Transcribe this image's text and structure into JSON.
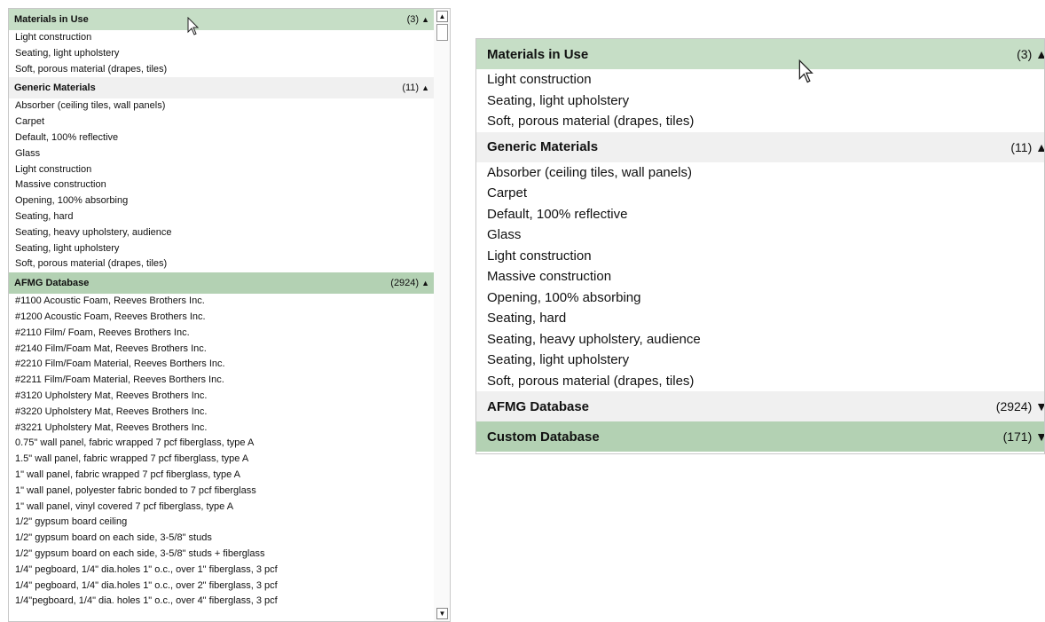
{
  "left_panel": {
    "sections": [
      {
        "title": "Materials in Use",
        "count": "(3)",
        "expanded": true,
        "items": [
          "Light construction",
          "Seating, light upholstery",
          "Soft, porous material (drapes, tiles)"
        ]
      },
      {
        "title": "Generic Materials",
        "count": "(11)",
        "expanded": true,
        "items": [
          "Absorber (ceiling tiles, wall panels)",
          "Carpet",
          "Default, 100% reflective",
          "Glass",
          "Light construction",
          "Massive construction",
          "Opening, 100% absorbing",
          "Seating, hard",
          "Seating, heavy upholstery, audience",
          "Seating, light upholstery",
          "Soft, porous material (drapes, tiles)"
        ]
      },
      {
        "title": "AFMG Database",
        "count": "(2924)",
        "expanded": true,
        "items": [
          "#1100 Acoustic Foam, Reeves Brothers Inc.",
          "#1200 Acoustic Foam, Reeves Brothers Inc.",
          "#2110 Film/ Foam, Reeves Brothers Inc.",
          "#2140 Film/Foam Mat, Reeves Brothers Inc.",
          "#2210 Film/Foam Material, Reeves Borthers Inc.",
          "#2211 Film/Foam Material, Reeves Borthers Inc.",
          "#3120 Upholstery Mat, Reeves Brothers Inc.",
          "#3220 Upholstery Mat, Reeves Brothers Inc.",
          "#3221 Upholstery Mat, Reeves Brothers Inc.",
          "0.75\" wall panel, fabric wrapped 7 pcf fiberglass, type A",
          "1.5\" wall panel, fabric wrapped 7 pcf fiberglass, type A",
          "1\" wall panel, fabric wrapped 7 pcf fiberglass, type A",
          "1\" wall panel, polyester fabric bonded to 7 pcf fiberglass",
          "1\" wall panel, vinyl covered 7 pcf fiberglass, type A",
          "1/2\" gypsum board ceiling",
          "1/2\" gypsum board on each side, 3-5/8\" studs",
          "1/2\" gypsum board on each side, 3-5/8\" studs + fiberglass",
          "1/4\" pegboard, 1/4\" dia.holes 1\" o.c., over 1\" fiberglass, 3 pcf",
          "1/4\" pegboard, 1/4\" dia.holes 1\" o.c., over 2\" fiberglass, 3 pcf",
          "1/4\"pegboard, 1/4\" dia. holes 1\" o.c., over 4\" fiberglass, 3 pcf"
        ]
      }
    ]
  },
  "right_panel": {
    "sections": [
      {
        "title": "Materials in Use",
        "count": "(3)",
        "expanded": true,
        "items": [
          "Light construction",
          "Seating, light upholstery",
          "Soft, porous material (drapes, tiles)"
        ]
      },
      {
        "title": "Generic Materials",
        "count": "(11)",
        "expanded": true,
        "items": [
          "Absorber (ceiling tiles, wall panels)",
          "Carpet",
          "Default, 100% reflective",
          "Glass",
          "Light construction",
          "Massive construction",
          "Opening, 100% absorbing",
          "Seating, hard",
          "Seating, heavy upholstery, audience",
          "Seating, light upholstery",
          "Soft, porous material (drapes, tiles)"
        ]
      },
      {
        "title": "AFMG Database",
        "count": "(2924)",
        "expanded": false,
        "items": []
      },
      {
        "title": "Custom Database",
        "count": "(171)",
        "expanded": false,
        "items": []
      }
    ]
  },
  "glyphs": {
    "expanded": "▲",
    "collapsed": "▼",
    "scroll_up": "▲",
    "scroll_down": "▼"
  },
  "colors": {
    "header_green": "#c6dec6",
    "header_green_dark": "#b3d1b3",
    "header_gray": "#f0f0f0"
  }
}
